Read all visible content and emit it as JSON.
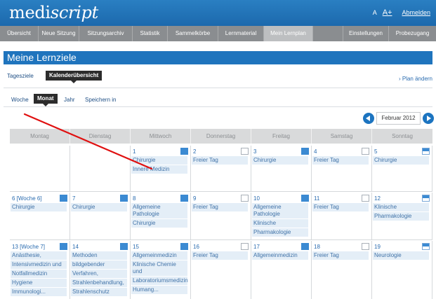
{
  "header": {
    "logo_main": "medi",
    "logo_italic": "script",
    "font_small": "A",
    "font_big": "A+",
    "logout": "Abmelden",
    "bg_color": "#1c6fb5"
  },
  "nav": {
    "items": [
      {
        "label": "Übersicht"
      },
      {
        "label": "Neue Sitzung"
      },
      {
        "label": "Sitzungsarchiv"
      },
      {
        "label": "Statistik"
      },
      {
        "label": "Sammelkörbe"
      },
      {
        "label": "Lernmaterial"
      },
      {
        "label": "Mein Lernplan"
      },
      {
        "label": "Einstellungen"
      },
      {
        "label": "Probezugang"
      }
    ],
    "active": "Mein Lernplan"
  },
  "page": {
    "title": "Meine Lernziele",
    "tab_tagesziele": "Tagesziele",
    "tab_kalender": "Kalenderübersicht",
    "plan_link": "› Plan ändern",
    "view_woche": "Woche",
    "view_monat": "Monat",
    "view_jahr": "Jahr",
    "save_in": "Speichern in"
  },
  "calendar": {
    "month_label": "Februar 2012",
    "weekdays": [
      "Montag",
      "Dienstag",
      "Mittwoch",
      "Donnerstag",
      "Freitag",
      "Samstag",
      "Sonntag"
    ],
    "week1": [
      {
        "day": "",
        "mark": "none",
        "entries": []
      },
      {
        "day": "",
        "mark": "none",
        "entries": []
      },
      {
        "day": "1",
        "mark": "blue",
        "entries": [
          "Chirurgie",
          "Innere Medizin"
        ]
      },
      {
        "day": "2",
        "mark": "empty",
        "entries": [
          "Freier Tag"
        ]
      },
      {
        "day": "3",
        "mark": "blue",
        "entries": [
          "Chirurgie"
        ]
      },
      {
        "day": "4",
        "mark": "empty",
        "entries": [
          "Freier Tag"
        ]
      },
      {
        "day": "5",
        "mark": "half",
        "entries": [
          "Chirurgie"
        ]
      }
    ],
    "week2": [
      {
        "day": "6 [Woche 6]",
        "mark": "blue",
        "entries": [
          "Chirurgie"
        ]
      },
      {
        "day": "7",
        "mark": "blue",
        "entries": [
          "Chirurgie"
        ]
      },
      {
        "day": "8",
        "mark": "blue",
        "entries": [
          "Allgemeine Pathologie",
          "Chirurgie"
        ]
      },
      {
        "day": "9",
        "mark": "empty",
        "entries": [
          "Freier Tag"
        ]
      },
      {
        "day": "10",
        "mark": "blue",
        "entries": [
          "Allgemeine Pathologie",
          "Klinische",
          "Pharmakologie"
        ]
      },
      {
        "day": "11",
        "mark": "empty",
        "entries": [
          "Freier Tag"
        ]
      },
      {
        "day": "12",
        "mark": "half",
        "entries": [
          "Klinische",
          "Pharmakologie"
        ]
      }
    ],
    "week3": [
      {
        "day": "13 [Woche 7]",
        "mark": "blue",
        "entries": [
          "Anästhesie,",
          "Intensivmedizin und",
          "Notfallmedizin",
          "Hygiene",
          "Immunologi..."
        ]
      },
      {
        "day": "14",
        "mark": "blue",
        "entries": [
          "Methoden",
          "bildgebender",
          "Verfahren,",
          "Strahlenbehandlung,",
          "Strahlenschutz"
        ]
      },
      {
        "day": "15",
        "mark": "blue",
        "entries": [
          "Allgemeinmedizin",
          "Klinische Chemie und",
          "Laboratoriumsmedizin",
          "Humang..."
        ]
      },
      {
        "day": "16",
        "mark": "empty",
        "entries": [
          "Freier Tag"
        ]
      },
      {
        "day": "17",
        "mark": "blue",
        "entries": [
          "Allgemeinmedizin"
        ]
      },
      {
        "day": "18",
        "mark": "empty",
        "entries": [
          "Freier Tag"
        ]
      },
      {
        "day": "19",
        "mark": "half",
        "entries": [
          "Neurologie"
        ]
      }
    ]
  },
  "annotation_color": "#e01010"
}
